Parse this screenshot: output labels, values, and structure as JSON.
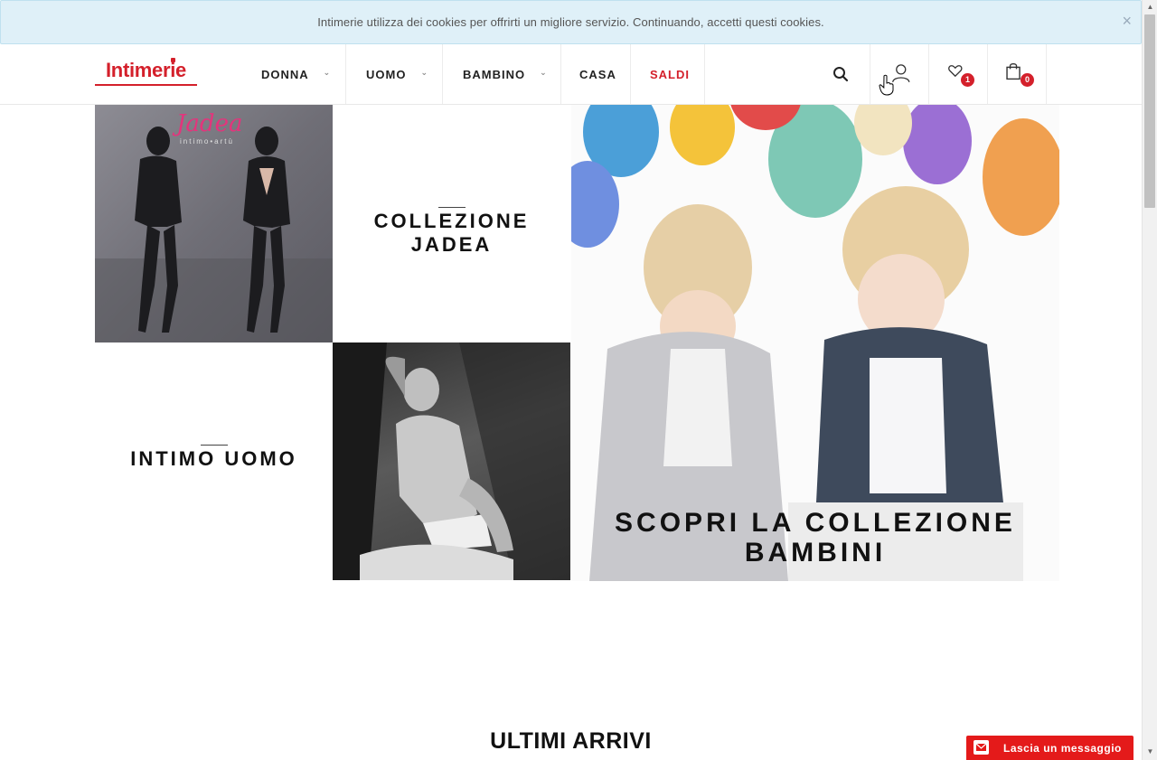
{
  "cookie_banner": {
    "text": "Intimerie utilizza dei cookies per offrirti un migliore servizio. Continuando, accetti questi cookies.",
    "close": "×"
  },
  "header": {
    "logo": "Intimerie",
    "nav": [
      {
        "label": "DONNA",
        "dropdown": true
      },
      {
        "label": "UOMO",
        "dropdown": true
      },
      {
        "label": "BAMBINO",
        "dropdown": true
      },
      {
        "label": "CASA",
        "dropdown": false
      },
      {
        "label": "SALDI",
        "dropdown": false
      }
    ],
    "wishlist_count": "1",
    "cart_count": "0"
  },
  "tiles": {
    "jadea_logo": "Jadea",
    "jadea_tagline": "intimo•artù",
    "jadea_caption": "COLLEZIONE JADEA",
    "uomo_caption": "INTIMO UOMO",
    "kids_caption_line1": "SCOPRI LA COLLEZIONE",
    "kids_caption_line2": "BAMBINI"
  },
  "section": {
    "title": "ULTIMI ARRIVI"
  },
  "chat": {
    "label": "Lascia un messaggio"
  },
  "colors": {
    "brand": "#d4202b",
    "cookie_bg": "#dff0f8",
    "chat": "#e41a1a"
  }
}
